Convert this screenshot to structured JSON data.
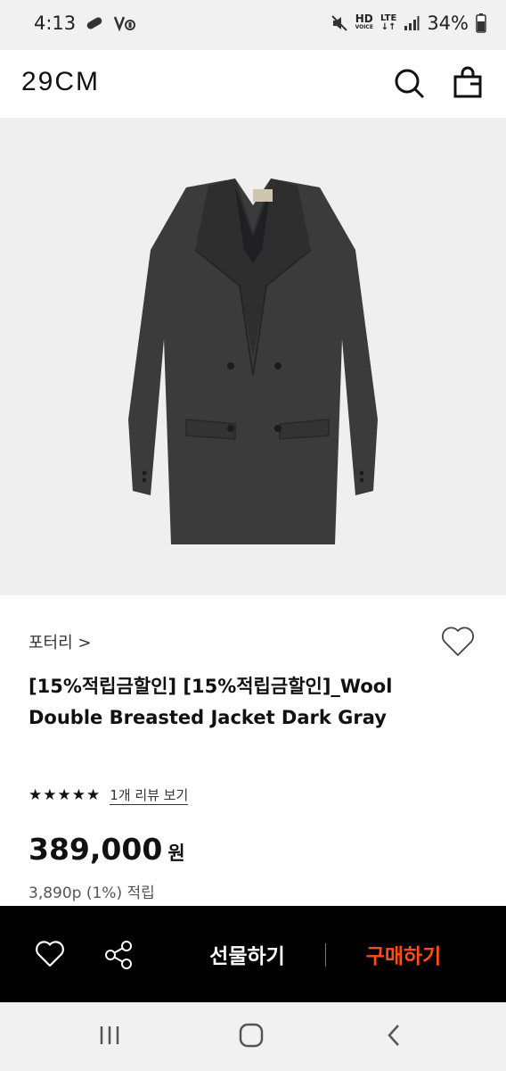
{
  "status_bar": {
    "time": "4:13",
    "hd": "HD",
    "voice": "VOICE",
    "lte": "LTE",
    "battery": "34%"
  },
  "header": {
    "logo": "29CM",
    "icons": [
      "search-icon",
      "shopping-bag-icon"
    ]
  },
  "product": {
    "image": "dark-gray-double-breasted-jacket",
    "brand": "포터리 >",
    "title": "[15%적립금할인] [15%적립금할인]_Wool Double Breasted Jacket Dark Gray",
    "stars": "★★★★★",
    "review_link": "1개 리뷰 보기",
    "price": "389,000",
    "price_unit": "원",
    "points": "3,890p (1%) 적립"
  },
  "buy_bar": {
    "gift_label": "선물하기",
    "buy_label": "구매하기",
    "buy_color": "#ff4d1a"
  },
  "nav_bar": {
    "icons": [
      "recent-apps-icon",
      "home-icon",
      "back-icon"
    ]
  }
}
